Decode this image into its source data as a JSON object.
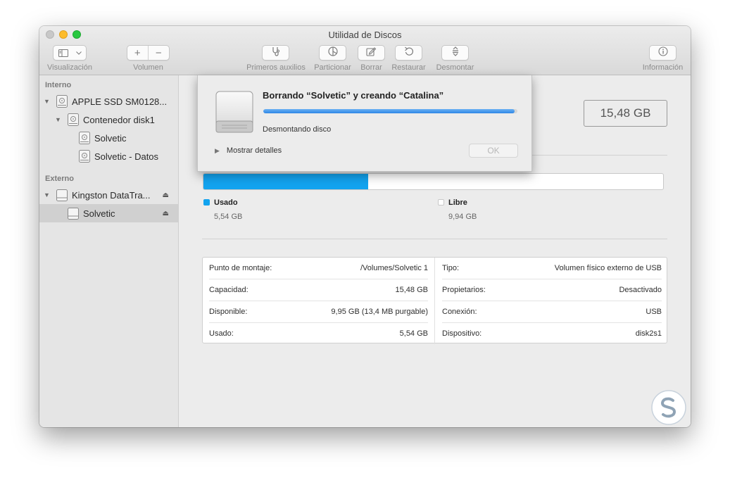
{
  "window": {
    "title": "Utilidad de Discos",
    "accent": "#12a3ef"
  },
  "toolbar": {
    "view_label": "Visualización",
    "volume_label": "Volumen",
    "first_aid_label": "Primeros auxilios",
    "partition_label": "Particionar",
    "erase_label": "Borrar",
    "restore_label": "Restaurar",
    "unmount_label": "Desmontar",
    "info_label": "Información",
    "add_glyph": "+",
    "remove_glyph": "−"
  },
  "sidebar": {
    "internal_header": "Interno",
    "external_header": "Externo",
    "items": [
      {
        "label": "APPLE SSD SM0128...",
        "icon": "internal-disk-icon"
      },
      {
        "label": "Contenedor disk1",
        "icon": "container-icon"
      },
      {
        "label": "Solvetic",
        "icon": "volume-icon"
      },
      {
        "label": "Solvetic - Datos",
        "icon": "volume-icon"
      },
      {
        "label": "Kingston DataTra...",
        "icon": "external-disk-icon"
      },
      {
        "label": "Solvetic",
        "icon": "external-volume-icon"
      }
    ],
    "eject_glyph": "⏏"
  },
  "main": {
    "capacity": "15,48 GB",
    "usage_fraction": 0.358,
    "legend": {
      "used_name": "Usado",
      "used_value": "5,54 GB",
      "used_color": "#12a3ef",
      "free_name": "Libre",
      "free_value": "9,94 GB",
      "free_color": "#ffffff"
    },
    "info_left": [
      {
        "key": "Punto de montaje:",
        "value": "/Volumes/Solvetic 1"
      },
      {
        "key": "Capacidad:",
        "value": "15,48 GB"
      },
      {
        "key": "Disponible:",
        "value": "9,95 GB (13,4 MB purgable)"
      },
      {
        "key": "Usado:",
        "value": "5,54 GB"
      }
    ],
    "info_right": [
      {
        "key": "Tipo:",
        "value": "Volumen físico externo de USB"
      },
      {
        "key": "Propietarios:",
        "value": "Desactivado"
      },
      {
        "key": "Conexión:",
        "value": "USB"
      },
      {
        "key": "Dispositivo:",
        "value": "disk2s1"
      }
    ]
  },
  "sheet": {
    "title": "Borrando “Solvetic” y creando “Catalina”",
    "status": "Desmontando disco",
    "progress_fraction": 0.99,
    "details_label": "Mostrar detalles",
    "ok_label": "OK"
  },
  "watermark": {
    "icon": "solvetic-logo-icon",
    "color": "#8fa3b5"
  }
}
